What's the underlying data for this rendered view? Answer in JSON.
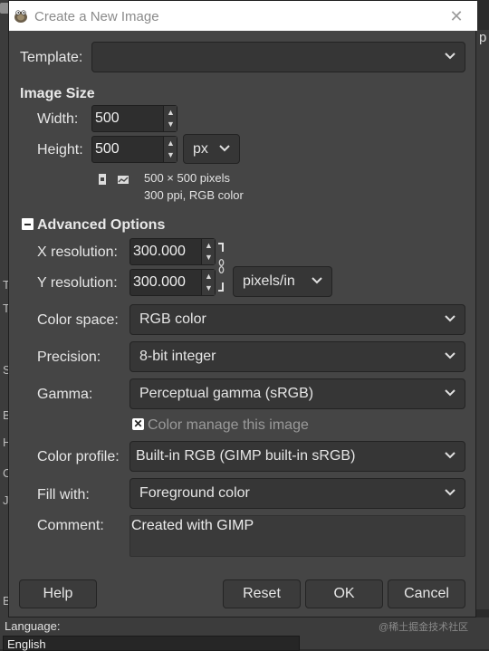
{
  "background": {
    "right_char": "p",
    "left_letters": [
      "T",
      "T",
      "S",
      "B",
      "H",
      "C",
      "J",
      "B"
    ],
    "language_label": "Language:",
    "language_value": "English",
    "watermark": "@稀土掘金技术社区"
  },
  "dialog": {
    "title": "Create a New Image",
    "template": {
      "label": "Template:",
      "value": ""
    },
    "image_size": {
      "heading": "Image Size",
      "width_label": "Width:",
      "width_value": "500",
      "height_label": "Height:",
      "height_value": "500",
      "unit": "px",
      "info_dimensions": "500 × 500 pixels",
      "info_resolution": "300 ppi, RGB color"
    },
    "advanced": {
      "heading": "Advanced Options",
      "x_res_label": "X resolution:",
      "x_res_value": "300.000",
      "y_res_label": "Y resolution:",
      "y_res_value": "300.000",
      "res_unit": "pixels/in",
      "color_space_label": "Color space:",
      "color_space_value": "RGB color",
      "precision_label": "Precision:",
      "precision_value": "8-bit integer",
      "gamma_label": "Gamma:",
      "gamma_value": "Perceptual gamma (sRGB)",
      "color_manage_label": "Color manage this image",
      "color_manage_checked": true,
      "color_profile_label": "Color profile:",
      "color_profile_value": "Built-in RGB (GIMP built-in sRGB)",
      "fill_label": "Fill with:",
      "fill_value": "Foreground color",
      "comment_label": "Comment:",
      "comment_value": "Created with GIMP"
    },
    "buttons": {
      "help": "Help",
      "reset": "Reset",
      "ok": "OK",
      "cancel": "Cancel"
    }
  },
  "icons": {
    "title": "gimp-wilber-icon",
    "close": "close-icon",
    "portrait": "portrait-icon",
    "landscape": "landscape-icon",
    "chain": "chain-link-icon",
    "chevron": "chevron-down-icon",
    "collapse": "minus-box-icon"
  }
}
